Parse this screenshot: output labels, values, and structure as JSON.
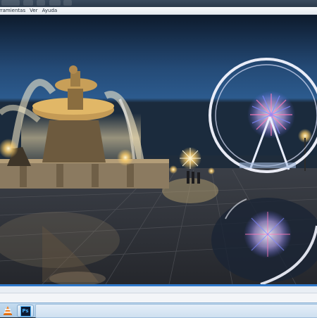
{
  "menu": {
    "items": [
      {
        "label": "rramientas"
      },
      {
        "label": "Ver"
      },
      {
        "label": "Ayuda"
      }
    ]
  },
  "image": {
    "description_icon": "photo-night-fountain-ferris-wheel"
  },
  "taskbar": {
    "apps": [
      {
        "name": "vlc",
        "icon": "vlc-cone-icon"
      },
      {
        "name": "photoshop",
        "icon": "photoshop-icon",
        "label": "Ps"
      }
    ]
  },
  "colors": {
    "accent_frame": "#2f78c9",
    "taskbar": "#b7d1ea"
  }
}
